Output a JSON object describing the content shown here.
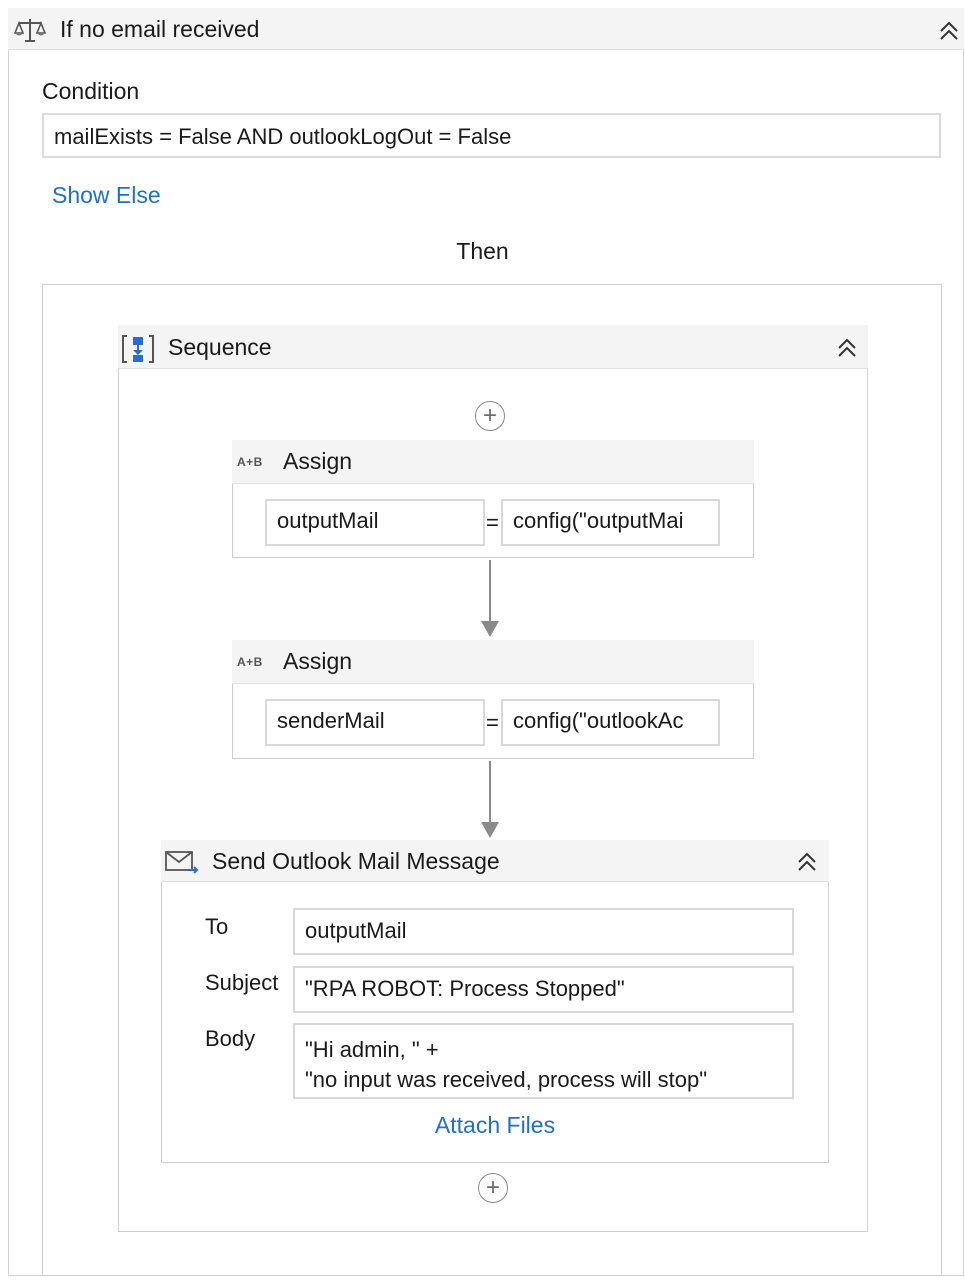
{
  "if_activity": {
    "title": "If no email received",
    "condition_label": "Condition",
    "condition_value": "mailExists = False AND outlookLogOut = False",
    "show_else_label": "Show Else",
    "then_label": "Then"
  },
  "sequence": {
    "title": "Sequence",
    "activities": [
      {
        "title": "Assign",
        "icon_text": "A+B",
        "to": "outputMail",
        "equals": "=",
        "value": "config(\"outputMai"
      },
      {
        "title": "Assign",
        "icon_text": "A+B",
        "to": "senderMail",
        "equals": "=",
        "value": "config(\"outlookAc"
      }
    ],
    "send_mail": {
      "title": "Send Outlook Mail Message",
      "to_label": "To",
      "to_value": "outputMail",
      "subject_label": "Subject",
      "subject_value": "\"RPA ROBOT: Process Stopped\"",
      "body_label": "Body",
      "body_value": "\"Hi admin, \" +\n\"no input was received, process will stop\"",
      "attach_label": "Attach Files"
    }
  },
  "icons": {
    "if": "if-scales-icon",
    "sequence": "sequence-icon",
    "assign": "assign-icon",
    "mail": "outlook-mail-icon",
    "collapse": "double-chevron-up-icon",
    "add": "plus-circle-icon"
  },
  "colors": {
    "link": "#1e6fce",
    "header_bg": "#f4f4f4",
    "border": "#cfcfcf"
  }
}
